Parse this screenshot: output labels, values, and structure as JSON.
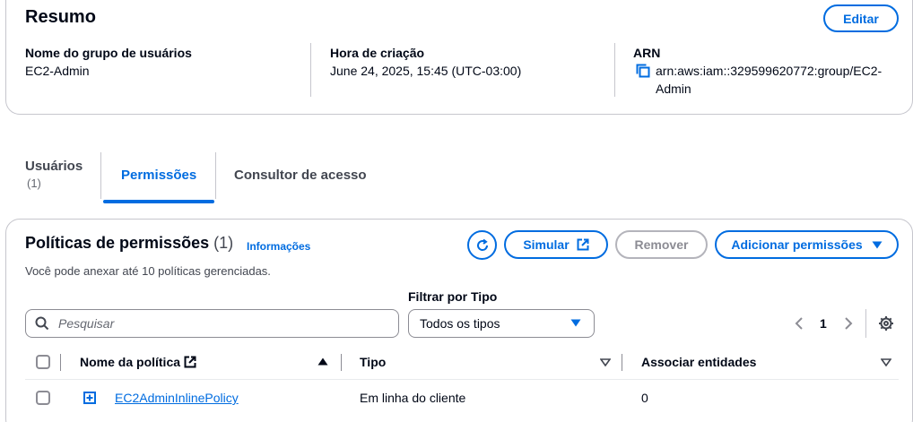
{
  "summary": {
    "title": "Resumo",
    "edit_label": "Editar",
    "fields": {
      "group_name_label": "Nome do grupo de usuários",
      "group_name_value": "EC2-Admin",
      "created_label": "Hora de criação",
      "created_value": "June 24, 2025, 15:45 (UTC-03:00)",
      "arn_label": "ARN",
      "arn_value_line1": "arn:aws:iam::329599620772:group/EC2-",
      "arn_value_line2": "Admin"
    }
  },
  "tabs": [
    {
      "label": "Usuários",
      "count": "(1)"
    },
    {
      "label": "Permissões",
      "active": true
    },
    {
      "label": "Consultor de acesso"
    }
  ],
  "policies": {
    "title": "Políticas de permissões",
    "count": "(1)",
    "info_label": "Informações",
    "description": "Você pode anexar até 10 políticas gerenciadas.",
    "simulate_label": "Simular",
    "remove_label": "Remover",
    "add_label": "Adicionar permissões",
    "filter_label": "Filtrar por Tipo",
    "search_placeholder": "Pesquisar",
    "filter_value": "Todos os tipos",
    "page": "1",
    "columns": [
      "Nome da política",
      "Tipo",
      "Associar entidades"
    ],
    "rows": [
      {
        "name": "EC2AdminInlinePolicy",
        "type": "Em linha do cliente",
        "entities": "0"
      }
    ]
  },
  "icons": {
    "copy": "copy-icon",
    "refresh": "refresh-icon",
    "external": "external-link-icon",
    "caret": "caret-down-icon",
    "settings": "gear-icon",
    "search": "search-icon",
    "expand": "expand-icon"
  },
  "colors": {
    "accent": "#006ce0",
    "border": "#c6c6cd",
    "text": "#000716"
  }
}
